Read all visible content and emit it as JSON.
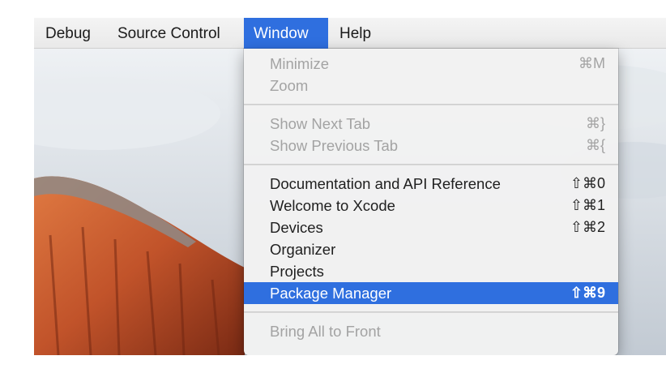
{
  "menubar": {
    "items": [
      {
        "label": "Debug"
      },
      {
        "label": "Source Control"
      },
      {
        "label": "Window"
      },
      {
        "label": "Help"
      }
    ],
    "active_index": 2
  },
  "window_menu": {
    "items": [
      {
        "label": "Minimize",
        "shortcut": "⌘M",
        "enabled": false
      },
      {
        "label": "Zoom",
        "shortcut": "",
        "enabled": false
      },
      {
        "label": "Show Next Tab",
        "shortcut": "⌘}",
        "enabled": false
      },
      {
        "label": "Show Previous Tab",
        "shortcut": "⌘{",
        "enabled": false
      },
      {
        "label": "Documentation and API Reference",
        "shortcut": "⇧⌘0",
        "enabled": true
      },
      {
        "label": "Welcome to Xcode",
        "shortcut": "⇧⌘1",
        "enabled": true
      },
      {
        "label": "Devices",
        "shortcut": "⇧⌘2",
        "enabled": true
      },
      {
        "label": "Organizer",
        "shortcut": "",
        "enabled": true
      },
      {
        "label": "Projects",
        "shortcut": "",
        "enabled": true
      },
      {
        "label": "Package Manager",
        "shortcut": "⇧⌘9",
        "enabled": true,
        "highlighted": true
      },
      {
        "label": "Bring All to Front",
        "shortcut": "",
        "enabled": false
      }
    ]
  },
  "colors": {
    "highlight": "#2f6fdf",
    "disabled_text": "#a3a3a3",
    "menu_text": "#1f1f1f"
  }
}
